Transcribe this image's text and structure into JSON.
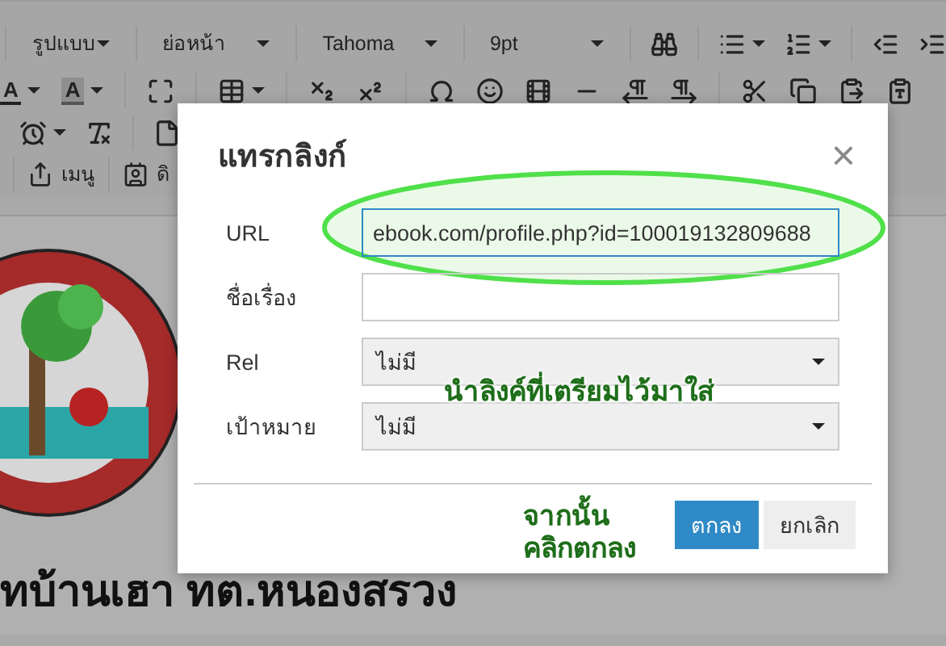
{
  "toolbar": {
    "dropdowns": [
      {
        "label": "รูปแบบ"
      },
      {
        "label": "ย่อหน้า"
      },
      {
        "label": "Tahoma"
      },
      {
        "label": "9pt"
      }
    ],
    "text_color_glyphs": [
      {
        "label": "A",
        "kind": "underline"
      },
      {
        "label": "A",
        "kind": "highlight"
      }
    ],
    "buttons": [
      {
        "label": "เมนู"
      },
      {
        "label": "ดิ"
      }
    ]
  },
  "content": {
    "heading": "ทบ้านเฮา ทต.หนองสรวง"
  },
  "dialog": {
    "title": "แทรกลิงก์",
    "close": "×",
    "fields": [
      {
        "label": "URL",
        "kind": "text",
        "value": "ebook.com/profile.php?id=100019132809688",
        "focused": true
      },
      {
        "label": "ชื่อเรื่อง",
        "kind": "text",
        "focused": false
      },
      {
        "label": "Rel",
        "kind": "select",
        "value": "ไม่มี",
        "focused": false
      },
      {
        "label": "เป้าหมาย",
        "kind": "select",
        "value": "ไม่มี",
        "focused": false
      }
    ],
    "buttons": [
      {
        "label": "ตกลง",
        "primary": true
      },
      {
        "label": "ยกเลิก",
        "primary": false
      }
    ]
  },
  "annotations": [
    {
      "text": "นำลิงค์ที่เตรียมไว้มาใส่"
    },
    {
      "text": "จากนั้น\nคลิกตกลง"
    }
  ]
}
